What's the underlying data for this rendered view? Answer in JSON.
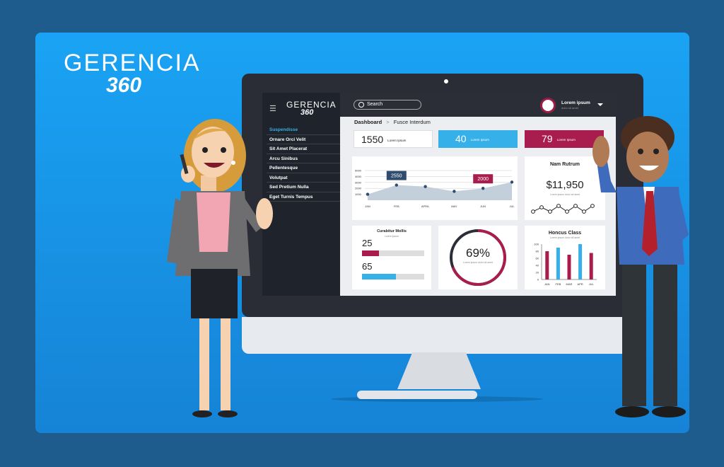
{
  "brand": {
    "line1": "GERENCIA",
    "line2": "360"
  },
  "app": {
    "logo_line1": "GERENCIA",
    "logo_line2": "360",
    "search_label": "Search",
    "user_name": "Lorem ipsum",
    "user_sub": "dolor sit amet",
    "breadcrumb": {
      "root": "Dashboard",
      "current": "Fusce Interdum"
    },
    "sidebar": [
      "Suspendisse",
      "Ornare Orci Velit",
      "Sit Amet Placerat",
      "Arcu Sinibus",
      "Pellentesque",
      "Volutpat",
      "Sed Pretium Nulla",
      "Eget Turnis Tempus"
    ]
  },
  "stats": [
    {
      "value": "1550",
      "label": "Lorem Ipsum",
      "color": "#ffffff"
    },
    {
      "value": "40",
      "label": "Lorem Ipsum",
      "color": "#35b0e8"
    },
    {
      "value": "79",
      "label": "Lorem Ipsum",
      "color": "#a81d4d"
    }
  ],
  "colors": {
    "accent_blue": "#35b0e8",
    "accent_red": "#a81d4d",
    "dark": "#2b2e37"
  },
  "main_chart": {
    "callout_a": "2550",
    "callout_a_sub": "Lorem ipsum",
    "callout_b": "2000",
    "callout_b_sub": "Lorem ipsum"
  },
  "nam_rutrum": {
    "title": "Nam Rutrum",
    "value": "$11,950",
    "sub": "Lorem ipsum dolor sit amet"
  },
  "curabitur": {
    "title": "Curabitur Mollis",
    "sub": "Lorem ipsum",
    "v1": "25",
    "v2": "65"
  },
  "gauge": {
    "value": "69%",
    "sub": "Lorem ipsum dolor sit amet"
  },
  "honcus": {
    "title": "Honcus Class",
    "sub": "Lorem ipsum dolor sit amet"
  },
  "chart_data": [
    {
      "type": "area",
      "categories": [
        "JAN",
        "FEB",
        "APRIL",
        "MAY",
        "JUN",
        "JUL"
      ],
      "values": [
        1000,
        2550,
        2300,
        1500,
        2000,
        3050
      ],
      "yticks": [
        "1000",
        "2000",
        "3000",
        "4000",
        "5000"
      ],
      "ylim": [
        0,
        5000
      ]
    },
    {
      "type": "bar",
      "title": "Honcus Class",
      "categories": [
        "JAN",
        "FEB",
        "MAR",
        "APR",
        "JUL"
      ],
      "series": [
        {
          "values": [
            80,
            80,
            70,
            70,
            75
          ]
        },
        {
          "values": [
            90,
            90,
            100,
            100,
            75
          ]
        }
      ],
      "yticks": [
        "100",
        "80",
        "60",
        "40",
        "20",
        "0"
      ],
      "ylim": [
        0,
        100
      ]
    }
  ]
}
